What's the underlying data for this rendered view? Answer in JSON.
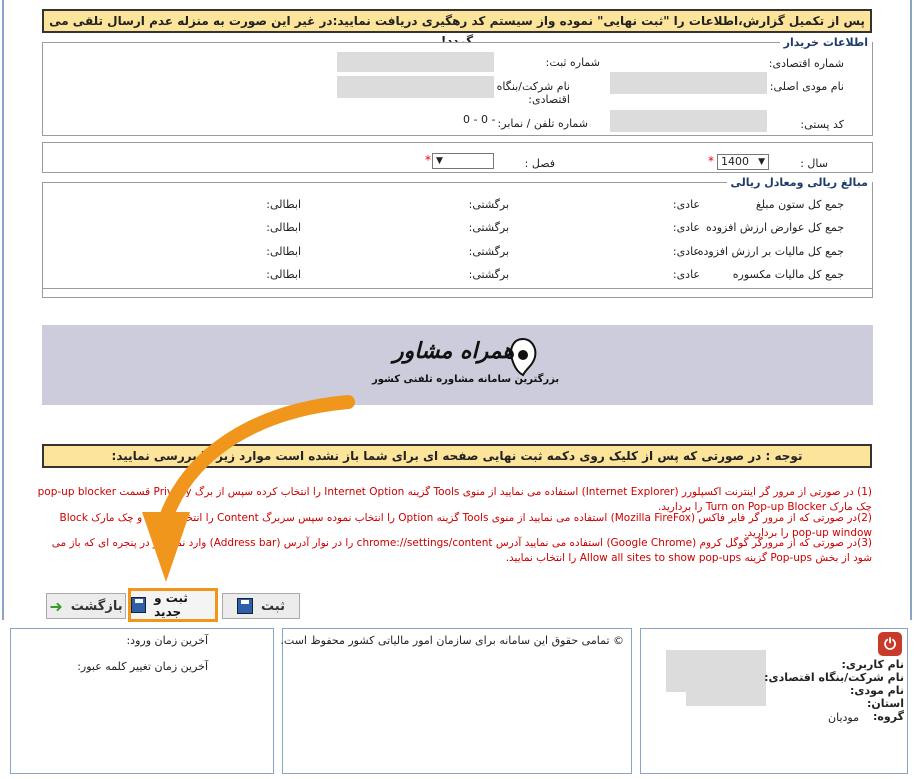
{
  "banner": {
    "text": "پس از تکمیل گزارش،اطلاعات را \"ثبت نهایی\" نموده واز سیستم کد رهگیری دریافت نمایید:در غیر این صورت به منزله عدم ارسال تلقی می گردد!"
  },
  "buyer": {
    "legend": "اطلاعات خریدار",
    "economic_code_label": "شماره اقتصادی:",
    "reg_no_label": "شماره ثبت:",
    "taxpayer_name_label": "نام مودی اصلی:",
    "company_label": "نام شرکت/بنگاه\nاقتصادی:",
    "postal_code_label": "کد پستی:",
    "phone_label": "شماره تلفن / نمابر:",
    "phone_value": "0 - 0 -"
  },
  "period": {
    "year_label": "سال :",
    "year_value": "1400",
    "season_label": "فصل :",
    "season_value": "",
    "required_mark": "*"
  },
  "amounts": {
    "legend": "مبالغ ریالی ومعادل ریالی",
    "rows": [
      {
        "title": "جمع کل ستون مبلغ",
        "normal": "عادی:",
        "return": "برگشتی:",
        "cancel": "ابطالی:"
      },
      {
        "title": "جمع کل عوارض ارزش افزوده",
        "normal": "عادی:",
        "return": "برگشتی:",
        "cancel": "ابطالی:"
      },
      {
        "title": "جمع کل مالیات بر ارزش افزوده",
        "normal": "عادی:",
        "return": "برگشتی:",
        "cancel": "ابطالی:"
      },
      {
        "title": "جمع کل مالیات مکسوره",
        "normal": "عادی:",
        "return": "برگشتی:",
        "cancel": "ابطالی:"
      }
    ]
  },
  "watermark": {
    "title": "همراه مشاور",
    "subtitle": "بزرگترین سامانه مشاوره تلفنی کشور"
  },
  "notice": {
    "text": "توجه : در صورتی که پس از کلیک روی دکمه ثبت نهایی صفحه ای برای شما باز نشده است موارد زیر را بررسی نمایید:"
  },
  "instructions": [
    "(1) در صورتی از مرور گر اینترنت اکسپلورر (Internet Explorer) استفاده می نمایید از منوی Tools گزینه Internet Option را انتخاب کرده سپس از برگ Privacy قسمت pop-up blocker چک مارک Turn on Pop-up Blocker را بردارید.",
    "(2)در صورتی که از مرور گر فایر فاکس (Mozilla FireFox) استفاده می نمایید از منوی Tools گزینه Option را انتخاب نموده سپس سربرگ Content را انتخاب نموده و چک مارک Block pop-up window را بردارید.",
    "(3)در صورتی که از مرورگر گوگل کروم (Google Chrome) استفاده می نمایید آدرس chrome://settings/content را در نوار آدرس (Address bar) وارد نمایید و در پنجره ای که باز می شود از بخش Pop-ups گزینه Allow all sites to show pop-ups را انتخاب نمایید."
  ],
  "buttons": {
    "submit": "ثبت",
    "submit_new": "ثبت و جدید",
    "back": "بازگشت"
  },
  "footer": {
    "last_login": "آخرین زمان ورود:",
    "last_pw_change": "آخرین زمان تغییر کلمه عبور:",
    "copyright": "© تمامی حقوق این سامانه برای سازمان امور مالیاتی کشور محفوظ است.",
    "username_label": "نام کاربری:",
    "company_label": "نام شرکت/بنگاه اقتصادی:",
    "taxpayer_label": "نام مودی:",
    "province_label": "استان:",
    "group_label": "گروه:",
    "group_value": "مودیان"
  },
  "colors": {
    "banner_bg": "#fde49b",
    "accent_orange": "#f0961c",
    "red_text": "#cc0000",
    "frame_blue": "#8aa4c8"
  }
}
